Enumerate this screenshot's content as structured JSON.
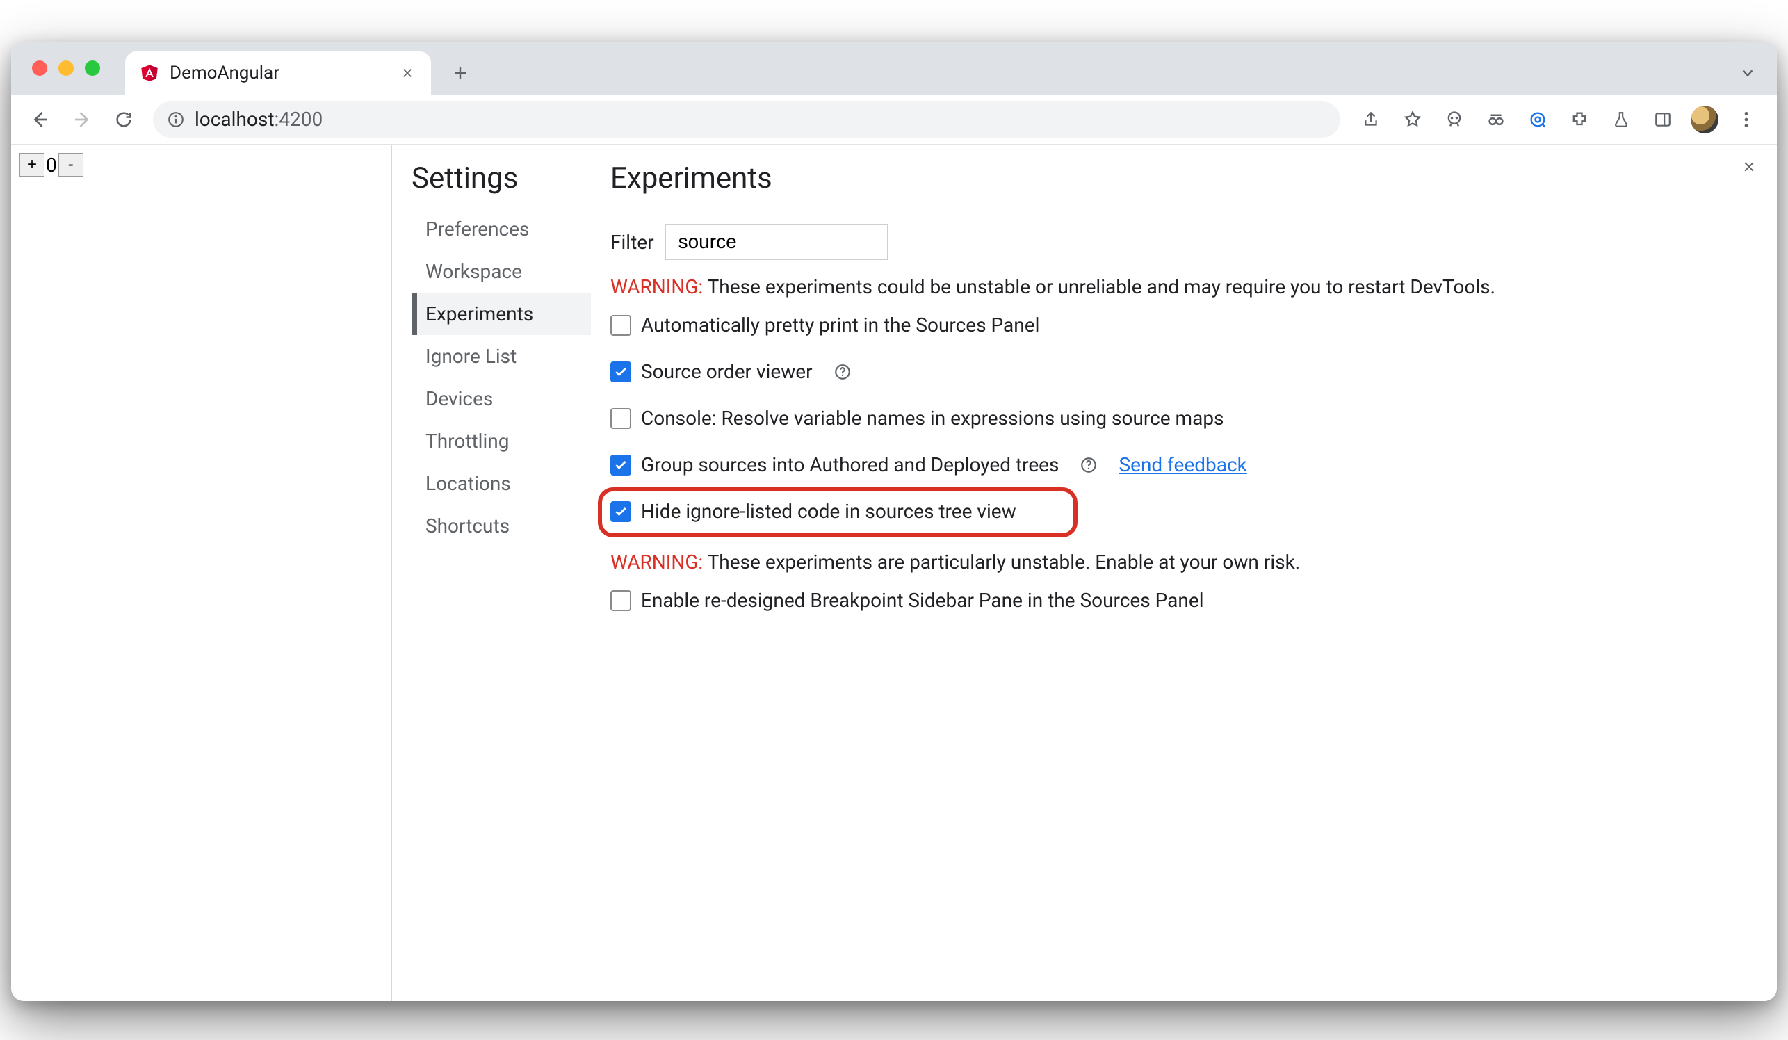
{
  "browser": {
    "tab": {
      "title": "DemoAngular",
      "favicon": "angular"
    },
    "url_host": "localhost",
    "url_port": ":4200"
  },
  "page_widget": {
    "plus": "+",
    "value": "0",
    "minus": "-"
  },
  "settings": {
    "title": "Settings",
    "nav": [
      {
        "label": "Preferences",
        "active": false
      },
      {
        "label": "Workspace",
        "active": false
      },
      {
        "label": "Experiments",
        "active": true
      },
      {
        "label": "Ignore List",
        "active": false
      },
      {
        "label": "Devices",
        "active": false
      },
      {
        "label": "Throttling",
        "active": false
      },
      {
        "label": "Locations",
        "active": false
      },
      {
        "label": "Shortcuts",
        "active": false
      }
    ]
  },
  "experiments": {
    "heading": "Experiments",
    "filter_label": "Filter",
    "filter_value": "source",
    "warning1_label": "WARNING:",
    "warning1_text": " These experiments could be unstable or unreliable and may require you to restart DevTools.",
    "list1": [
      {
        "label": "Automatically pretty print in the Sources Panel",
        "checked": false,
        "help": false,
        "link": null,
        "highlighted": false
      },
      {
        "label": "Source order viewer",
        "checked": true,
        "help": true,
        "link": null,
        "highlighted": false
      },
      {
        "label": "Console: Resolve variable names in expressions using source maps",
        "checked": false,
        "help": false,
        "link": null,
        "highlighted": false
      },
      {
        "label": "Group sources into Authored and Deployed trees",
        "checked": true,
        "help": true,
        "link": "Send feedback",
        "highlighted": false
      },
      {
        "label": "Hide ignore-listed code in sources tree view",
        "checked": true,
        "help": false,
        "link": null,
        "highlighted": true
      }
    ],
    "warning2_label": "WARNING:",
    "warning2_text": " These experiments are particularly unstable. Enable at your own risk.",
    "list2": [
      {
        "label": "Enable re-designed Breakpoint Sidebar Pane in the Sources Panel",
        "checked": false,
        "help": false,
        "link": null,
        "highlighted": false
      }
    ]
  }
}
